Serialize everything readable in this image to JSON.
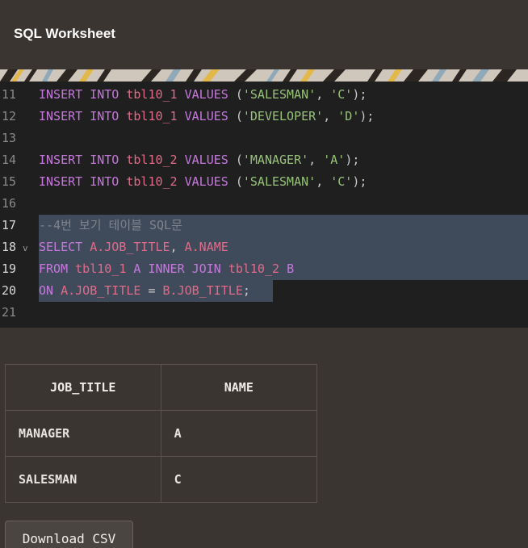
{
  "app": {
    "title": "SQL Worksheet"
  },
  "editor": {
    "lines": [
      {
        "num": "11",
        "tokens": [
          [
            "kw",
            "INSERT INTO "
          ],
          [
            "fn",
            "tbl10_1 "
          ],
          [
            "kw",
            "VALUES "
          ],
          [
            "pl",
            "("
          ],
          [
            "str",
            "'SALESMAN'"
          ],
          [
            "pl",
            ", "
          ],
          [
            "str",
            "'C'"
          ],
          [
            "pl",
            ");"
          ]
        ]
      },
      {
        "num": "12",
        "tokens": [
          [
            "kw",
            "INSERT INTO "
          ],
          [
            "fn",
            "tbl10_1 "
          ],
          [
            "kw",
            "VALUES "
          ],
          [
            "pl",
            "("
          ],
          [
            "str",
            "'DEVELOPER'"
          ],
          [
            "pl",
            ", "
          ],
          [
            "str",
            "'D'"
          ],
          [
            "pl",
            ");"
          ]
        ]
      },
      {
        "num": "13",
        "tokens": []
      },
      {
        "num": "14",
        "tokens": [
          [
            "kw",
            "INSERT INTO "
          ],
          [
            "fn",
            "tbl10_2 "
          ],
          [
            "kw",
            "VALUES "
          ],
          [
            "pl",
            "("
          ],
          [
            "str",
            "'MANAGER'"
          ],
          [
            "pl",
            ", "
          ],
          [
            "str",
            "'A'"
          ],
          [
            "pl",
            ");"
          ]
        ]
      },
      {
        "num": "15",
        "tokens": [
          [
            "kw",
            "INSERT INTO "
          ],
          [
            "fn",
            "tbl10_2 "
          ],
          [
            "kw",
            "VALUES "
          ],
          [
            "pl",
            "("
          ],
          [
            "str",
            "'SALESMAN'"
          ],
          [
            "pl",
            ", "
          ],
          [
            "str",
            "'C'"
          ],
          [
            "pl",
            ");"
          ]
        ]
      },
      {
        "num": "16",
        "tokens": []
      },
      {
        "num": "17",
        "tokens": [
          [
            "com",
            "--4번 보기 테이블 SQL문"
          ]
        ]
      },
      {
        "num": "18",
        "tokens": [
          [
            "kw",
            "SELECT "
          ],
          [
            "fn",
            "A.JOB_TITLE"
          ],
          [
            "pl",
            ", "
          ],
          [
            "fn",
            "A.NAME"
          ]
        ]
      },
      {
        "num": "19",
        "tokens": [
          [
            "kw",
            "FROM "
          ],
          [
            "fn",
            "tbl10_1 "
          ],
          [
            "kw",
            "A INNER JOIN "
          ],
          [
            "fn",
            "tbl10_2 "
          ],
          [
            "kw",
            "B"
          ]
        ]
      },
      {
        "num": "20",
        "tokens": [
          [
            "kw",
            "ON "
          ],
          [
            "fn",
            "A.JOB_TITLE "
          ],
          [
            "pl",
            "= "
          ],
          [
            "fn",
            "B.JOB_TITLE"
          ],
          [
            "pl",
            ";"
          ]
        ]
      },
      {
        "num": "21",
        "tokens": []
      }
    ]
  },
  "results": {
    "columns": [
      "JOB_TITLE",
      "NAME"
    ],
    "rows": [
      [
        "MANAGER",
        "A"
      ],
      [
        "SALESMAN",
        "C"
      ]
    ]
  },
  "actions": {
    "download_label": "Download CSV"
  },
  "icons": {
    "fold": "chevron-down-icon"
  },
  "colors": {
    "background": "#3a3531",
    "editor_bg": "#1f1f1f",
    "selection": "#3f4a5a",
    "keyword": "#c678dd",
    "string": "#98c379",
    "comment": "#7f848e",
    "identifier": "#e06c8a"
  }
}
